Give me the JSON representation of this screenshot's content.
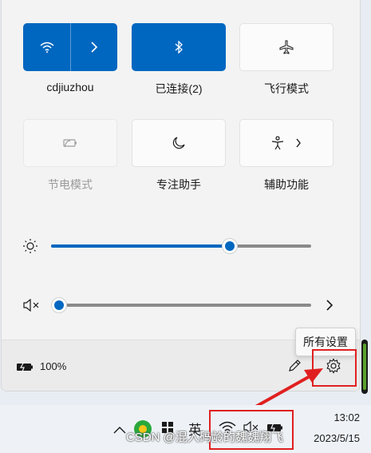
{
  "quick_settings": {
    "tiles_row1": [
      {
        "label": "cdjiuzhou",
        "icon": "wifi-icon",
        "state": "on"
      },
      {
        "label": "已连接(2)",
        "icon": "bluetooth-icon",
        "state": "on"
      },
      {
        "label": "飞行模式",
        "icon": "airplane-icon",
        "state": "off"
      }
    ],
    "tiles_row2": [
      {
        "label": "节电模式",
        "icon": "battery-saver-icon",
        "state": "disabled"
      },
      {
        "label": "专注助手",
        "icon": "moon-icon",
        "state": "off"
      },
      {
        "label": "辅助功能",
        "icon": "accessibility-icon",
        "state": "off"
      }
    ],
    "brightness": {
      "icon": "sun-icon",
      "value_percent": 75
    },
    "volume": {
      "icon": "mute-speaker-icon",
      "value_percent": 0
    }
  },
  "footer": {
    "battery_label": "100%",
    "edit_icon": "pencil-icon",
    "settings_icon": "gear-icon",
    "settings_tooltip": "所有设置"
  },
  "taskbar": {
    "time": "13:02",
    "date": "2023/5/15",
    "ime_label": "英"
  },
  "watermark": "CSDN @混入码龄的魏魏翔飞"
}
